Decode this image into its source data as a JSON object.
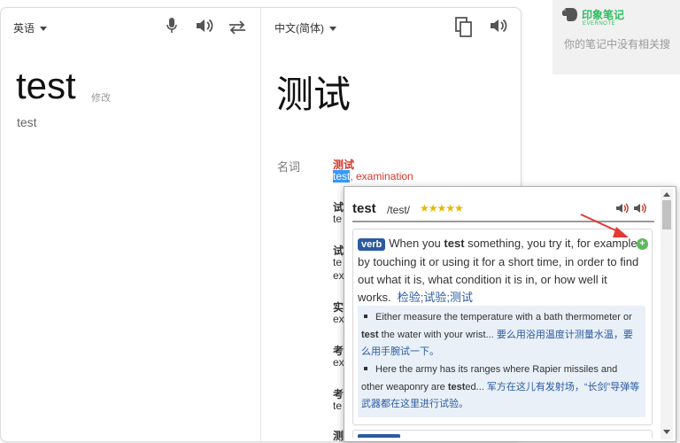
{
  "translator": {
    "source_lang": "英语",
    "target_lang": "中文(简体)",
    "source_text": "test",
    "edit_label": "修改",
    "source_transliteration": "test",
    "translation": "测试",
    "dictionary": {
      "pos": "名词",
      "headword": "测试",
      "synonyms_highlight": "test",
      "synonyms_rest": ", examination",
      "truncated_lines": [
        "试",
        "te",
        "试",
        "te",
        "ex",
        "实",
        "ex",
        "考",
        "ex",
        "考",
        "te",
        "测"
      ]
    }
  },
  "evernote": {
    "title": "印象笔记",
    "subtitle": "EVERNOTE",
    "message": "你的笔记中没有相关搜"
  },
  "popup": {
    "word": "test",
    "phonetic": "/test/",
    "stars": "★★★★★",
    "entry": {
      "pos": "verb",
      "def_pre": "When you ",
      "def_bold": "test",
      "def_post": " something, you try it, for example by touching it or using it for a short time, in order to find out what it is, what condition it is in, or how well it works.",
      "def_cn": "检验;试验;测试",
      "examples": [
        {
          "pre": "Either measure the temperature with a bath thermometer or ",
          "bold": "test",
          "post": " the water with your wrist...",
          "cn": "要么用浴用温度计测量水温，要么用手腕试一下。"
        },
        {
          "pre": "Here the army has its ranges where Rapier missiles and other weaponry are ",
          "bold": "test",
          "post": "ed...",
          "cn": "军方在这儿有发射场，“长剑”导弹等武器都在这里进行试验。"
        }
      ]
    }
  },
  "colors": {
    "accent_blue": "#2c5aa0",
    "dictionary_red": "#d0392b",
    "evernote_green": "#2dbe60",
    "star_gold": "#e6b800"
  }
}
